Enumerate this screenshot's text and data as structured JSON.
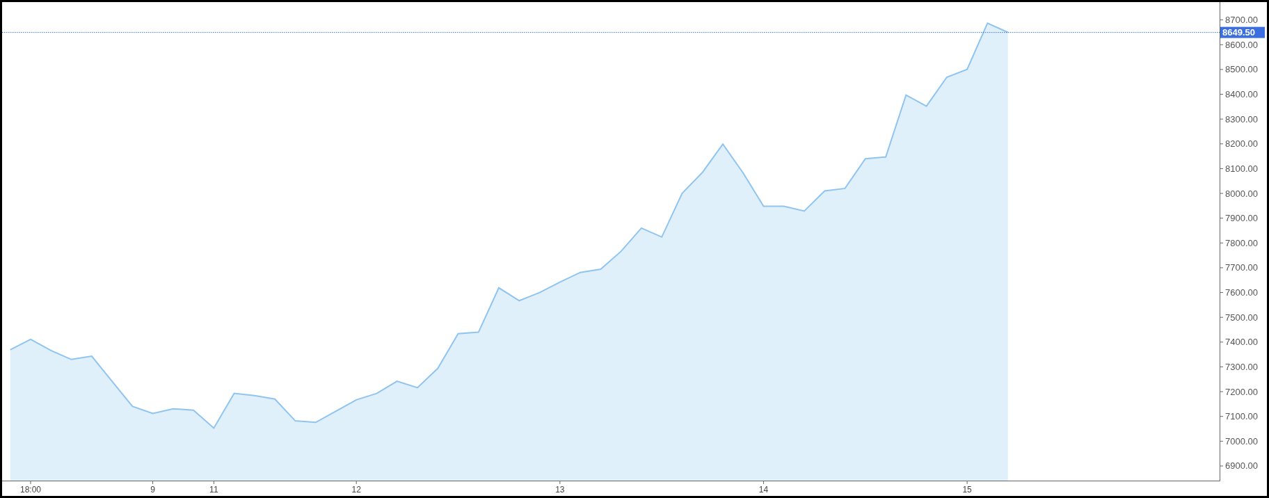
{
  "chart_data": {
    "type": "area",
    "categories": [
      null,
      "18:00",
      null,
      null,
      null,
      null,
      null,
      "9",
      null,
      null,
      "11",
      null,
      null,
      null,
      null,
      null,
      null,
      "12",
      null,
      null,
      null,
      null,
      null,
      null,
      null,
      null,
      null,
      "13",
      null,
      null,
      null,
      null,
      null,
      null,
      null,
      null,
      null,
      "14",
      null,
      null,
      null,
      null,
      null,
      null,
      null,
      null,
      null,
      "15",
      null,
      null,
      null,
      null,
      null,
      null,
      null,
      null,
      null,
      null,
      null,
      null
    ],
    "series": [
      {
        "color": "#90c4f0",
        "values": [
          7369,
          7411,
          7366,
          7330,
          7343,
          7242,
          7141,
          7112,
          7131,
          7125,
          7053,
          7193,
          7184,
          7170,
          7082,
          7076,
          7121,
          7167,
          7193,
          7242,
          7216,
          7294,
          7434,
          7440,
          7619,
          7567,
          7600,
          7642,
          7681,
          7694,
          7766,
          7860,
          7824,
          8000,
          8085,
          8199,
          8082,
          7948,
          7948,
          7929,
          8010,
          8020,
          8140,
          8147,
          8397,
          8352,
          8469,
          8501,
          8687,
          8650,
          null,
          null,
          null,
          null,
          null,
          null,
          null,
          null,
          null,
          null
        ]
      }
    ],
    "ylim": [
      6841,
      8772
    ],
    "yticks": [
      {
        "value": 6900,
        "label": "6900.00"
      },
      {
        "value": 7000,
        "label": "7000.00"
      },
      {
        "value": 7100,
        "label": "7100.00"
      },
      {
        "value": 7200,
        "label": "7200.00"
      },
      {
        "value": 7300,
        "label": "7300.00"
      },
      {
        "value": 7400,
        "label": "7400.00"
      },
      {
        "value": 7500,
        "label": "7500.00"
      },
      {
        "value": 7600,
        "label": "7600.00"
      },
      {
        "value": 7700,
        "label": "7700.00"
      },
      {
        "value": 7800,
        "label": "7800.00"
      },
      {
        "value": 7900,
        "label": "7900.00"
      },
      {
        "value": 8000,
        "label": "8000.00"
      },
      {
        "value": 8100,
        "label": "8100.00"
      },
      {
        "value": 8200,
        "label": "8200.00"
      },
      {
        "value": 8300,
        "label": "8300.00"
      },
      {
        "value": 8400,
        "label": "8400.00"
      },
      {
        "value": 8500,
        "label": "8500.00"
      },
      {
        "value": 8600,
        "label": "8600.00"
      },
      {
        "value": 8700,
        "label": "8700.00"
      }
    ],
    "ref_lines": [
      {
        "axis": "y",
        "value": 8649.5,
        "label": "8649.50"
      }
    ]
  }
}
